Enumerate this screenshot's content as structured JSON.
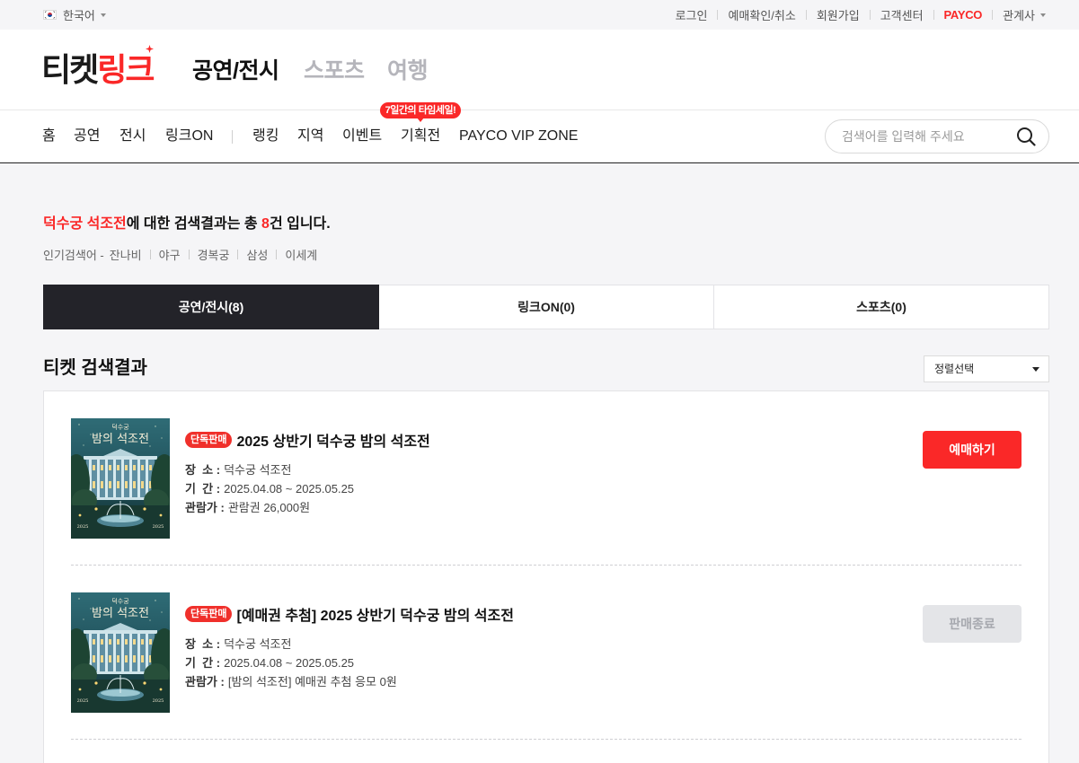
{
  "topbar": {
    "language": "한국어",
    "links": {
      "login": "로그인",
      "reservation": "예매확인/취소",
      "signup": "회원가입",
      "support": "고객센터",
      "payco": "PAYCO",
      "affiliates": "관계사"
    }
  },
  "header": {
    "logo": {
      "main": "티켓",
      "accent": "링크"
    },
    "categories": [
      {
        "label": "공연/전시",
        "active": true
      },
      {
        "label": "스포츠",
        "active": false
      },
      {
        "label": "여행",
        "active": false
      }
    ]
  },
  "nav": {
    "items": [
      "홈",
      "공연",
      "전시",
      "링크ON",
      "랭킹",
      "지역",
      "이벤트",
      "기획전",
      "PAYCO VIP ZONE"
    ],
    "badge": "7일간의 타임세일!",
    "search_placeholder": "검색어를 입력해 주세요"
  },
  "search_result": {
    "keyword": "덕수궁 석조전",
    "text_mid": "에 대한 검색결과는 총 ",
    "count": "8",
    "text_end": "건 입니다."
  },
  "popular": {
    "label": "인기검색어 -",
    "keywords": [
      "잔나비",
      "야구",
      "경복궁",
      "삼성",
      "이세계"
    ]
  },
  "tabs": [
    {
      "label": "공연/전시(8)",
      "active": true
    },
    {
      "label": "링크ON(0)",
      "active": false
    },
    {
      "label": "스포츠(0)",
      "active": false
    }
  ],
  "section_title": "티켓 검색결과",
  "sort": {
    "selected": "정렬선택"
  },
  "results": [
    {
      "poster": {
        "top": "덕수궁",
        "title": "밤의 석조전",
        "year": "2025"
      },
      "badge": "단독판매",
      "title": "2025 상반기 덕수궁 밤의 석조전",
      "details": [
        {
          "label": "장  소 :",
          "value": "덕수궁 석조전"
        },
        {
          "label": "기  간 :",
          "value": "2025.04.08 ~ 2025.05.25"
        },
        {
          "label": "관람가 :",
          "value": "관람권 26,000원"
        }
      ],
      "button": "예매하기"
    },
    {
      "poster": {
        "top": "덕수궁",
        "title": "밤의 석조전",
        "year": "2025"
      },
      "badge": "단독판매",
      "title": "[예매권 추첨] 2025 상반기 덕수궁 밤의 석조전",
      "details": [
        {
          "label": "장  소 :",
          "value": "덕수궁 석조전"
        },
        {
          "label": "기  간 :",
          "value": "2025.04.08 ~ 2025.05.25"
        },
        {
          "label": "관람가 :",
          "value": "[밤의 석조전] 예매권 추첨 응모 0원"
        }
      ],
      "button": "판매종료"
    }
  ],
  "colors": {
    "accent": "#fa2828",
    "active_tab": "#232329",
    "disabled_button": "#e4e5e8",
    "page_bg": "#f5f5f7"
  }
}
